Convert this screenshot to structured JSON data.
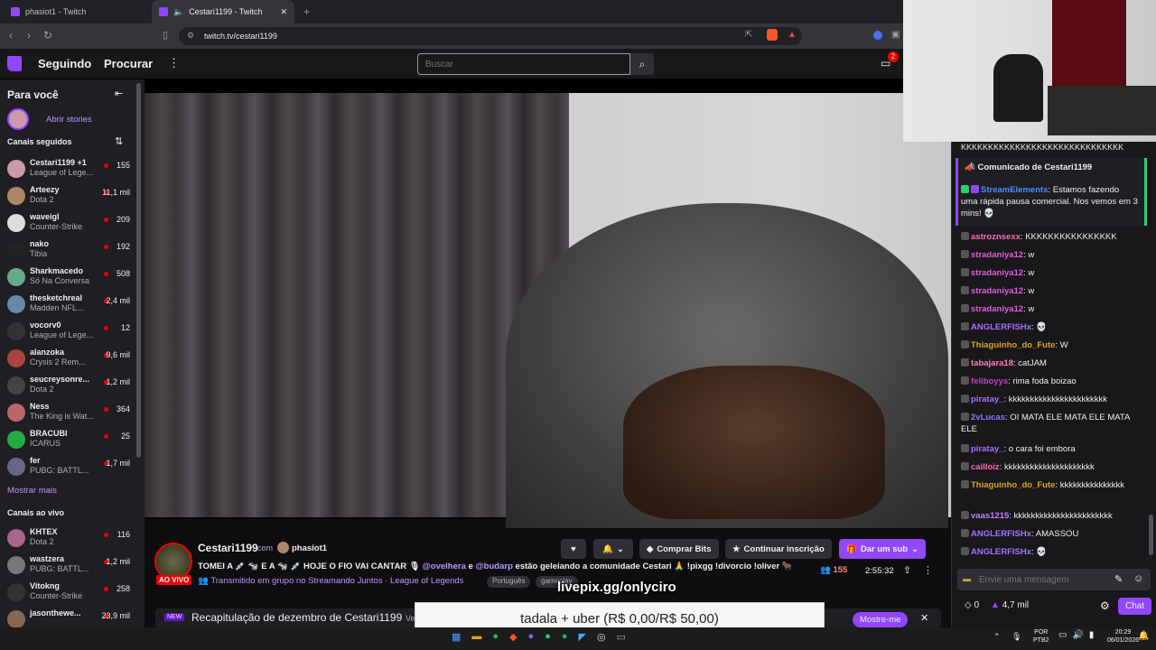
{
  "browser": {
    "tabs": [
      {
        "label": "phasiot1 - Twitch"
      },
      {
        "label": "Cestari1199 - Twitch"
      }
    ],
    "url": "twitch.tv/cestari1199"
  },
  "topnav": {
    "following": "Seguindo",
    "browse": "Procurar",
    "search_placeholder": "Buscar",
    "notif_count": "2"
  },
  "sidebar": {
    "for_you": "Para você",
    "open_stories": "Abrir stories",
    "followed_header": "Canais seguidos",
    "followed": [
      {
        "name": "Cestari1199 +1",
        "game": "League of Lege...",
        "viewers": "155",
        "color": "#c9a"
      },
      {
        "name": "Arteezy",
        "game": "Dota 2",
        "viewers": "11,1 mil",
        "color": "#a86"
      },
      {
        "name": "waveigl",
        "game": "Counter-Strike",
        "viewers": "209",
        "color": "#ddd"
      },
      {
        "name": "nako",
        "game": "Tibia",
        "viewers": "192",
        "color": "#222"
      },
      {
        "name": "Sharkmacedo",
        "game": "Só Na Conversa",
        "viewers": "508",
        "color": "#6a8"
      },
      {
        "name": "thesketchreal",
        "game": "Madden NFL...",
        "viewers": "2,4 mil",
        "color": "#68a"
      },
      {
        "name": "vocorv0",
        "game": "League of Lege...",
        "viewers": "12",
        "color": "#333"
      },
      {
        "name": "alanzoka",
        "game": "Crysis 2 Rem...",
        "viewers": "9,6 mil",
        "color": "#a44"
      },
      {
        "name": "seucreysonre...",
        "game": "Dota 2",
        "viewers": "1,2 mil",
        "color": "#444"
      },
      {
        "name": "Ness",
        "game": "The King is Wat...",
        "viewers": "364",
        "color": "#b66"
      },
      {
        "name": "BRACUBI",
        "game": "ICARUS",
        "viewers": "25",
        "color": "#2a4"
      },
      {
        "name": "fer",
        "game": "PUBG: BATTL...",
        "viewers": "1,7 mil",
        "color": "#668"
      }
    ],
    "show_more": "Mostrar mais",
    "live_header": "Canais ao vivo",
    "live": [
      {
        "name": "KHTEX",
        "game": "Dota 2",
        "viewers": "116",
        "color": "#a68"
      },
      {
        "name": "wastzera",
        "game": "PUBG: BATTL...",
        "viewers": "1,2 mil",
        "color": "#777"
      },
      {
        "name": "Vitokng",
        "game": "Counter-Strike",
        "viewers": "258",
        "color": "#333"
      },
      {
        "name": "jasonthewe...",
        "game": "",
        "viewers": "23,9 mil",
        "color": "#865"
      }
    ]
  },
  "stream": {
    "channel": "Cestari1199",
    "with": "com",
    "cohost": "phasiot1",
    "live_badge": "AO VIVO",
    "title_a": "TOMEI A 💉 🐄 E A 🐄 💉 HOJE O FIO VAI CANTAR 🎙 ",
    "mention1": "@ovelhera",
    "title_and": " e ",
    "mention2": "@budarp",
    "title_b": " estão geleiando a comunidade Cestari 🙏 !pixgg !divorcio !oliver 🐂",
    "group": "Transmitido em grupo no Streamando Juntos · ",
    "game": "League of Legends",
    "tags": [
      "Português",
      "gameplay"
    ],
    "viewers": "155",
    "uptime": "2:55:32",
    "buttons": {
      "bits": "Comprar Bits",
      "continue_sub": "Continuar inscrição",
      "gift": "Dar um sub"
    }
  },
  "recap": {
    "new": "NEW",
    "text": "Recapitulação de dezembro de Cestari1199",
    "after": "Ve",
    "show_me": "Mostre-me"
  },
  "overlay": {
    "livepix": "livepix.gg/onlyciro",
    "donation": "tadala + uber (R$ 0,00/R$ 50,00)"
  },
  "chat": {
    "top_line": "KKKKKKKKKKKKKKKKKKKKKKKKKKKKKK",
    "announce_title": "Comunicado de Cestari1199",
    "announce_user": "StreamElements",
    "announce_text": ": Estamos fazendo uma rápida pausa comercial. Nos vemos em 3 mins! 💀",
    "messages": [
      {
        "user": "astroznsexx",
        "text": ": KKKKKKKKKKKKKKKK",
        "color": "#ff69b4"
      },
      {
        "user": "stradaniya12",
        "text": ": w",
        "color": "#e05ce0"
      },
      {
        "user": "stradaniya12",
        "text": ": w",
        "color": "#e05ce0"
      },
      {
        "user": "stradaniya12",
        "text": ": w",
        "color": "#e05ce0"
      },
      {
        "user": "stradaniya12",
        "text": ": w",
        "color": "#e05ce0"
      },
      {
        "user": "ANGLERFISHx",
        "text": ": 💀",
        "color": "#a970ff"
      },
      {
        "user": "Thiaguinho_do_Fute",
        "text": ": W",
        "color": "#daa520"
      },
      {
        "user": "tabajara18",
        "text": ": catJAM",
        "color": "#ff7eb6"
      },
      {
        "user": "feliboyys",
        "text": ": rima foda boizao",
        "color": "#c040c0"
      },
      {
        "user": "piratay_",
        "text": ": kkkkkkkkkkkkkkkkkkkkkkk",
        "color": "#a970ff"
      },
      {
        "user": "2vLucas",
        "text": ": OI MATA ELE MATA ELE MATA ELE",
        "color": "#8a7aff"
      },
      {
        "user": "piratay_",
        "text": ": o cara foi embora",
        "color": "#a970ff"
      },
      {
        "user": "cailloiz",
        "text": ": kkkkkkkkkkkkkkkkkkkkk",
        "color": "#ff69b4"
      },
      {
        "user": "Thiaguinho_do_Fute",
        "text": ": kkkkkkkkkkkkkkk",
        "color": "#daa520"
      },
      {
        "user": "vaas1215",
        "text": ": kkkkkkkkkkkkkkkkkkkkkkk",
        "color": "#c080ff"
      },
      {
        "user": "ANGLERFISHx",
        "text": ": AMASSOU",
        "color": "#a970ff"
      },
      {
        "user": "ANGLERFISHx",
        "text": ": 💀",
        "color": "#a970ff"
      }
    ],
    "input_placeholder": "Envie uma mensagem",
    "points": "0",
    "bits": "4,7 mil",
    "chat_button": "Chat"
  },
  "taskbar": {
    "lang": "POR",
    "layout": "PTB2",
    "time": "20:29",
    "date": "06/01/2026"
  },
  "colors": {
    "accent": "#9147ff",
    "live_red": "#eb0400",
    "link": "#bf94ff"
  }
}
